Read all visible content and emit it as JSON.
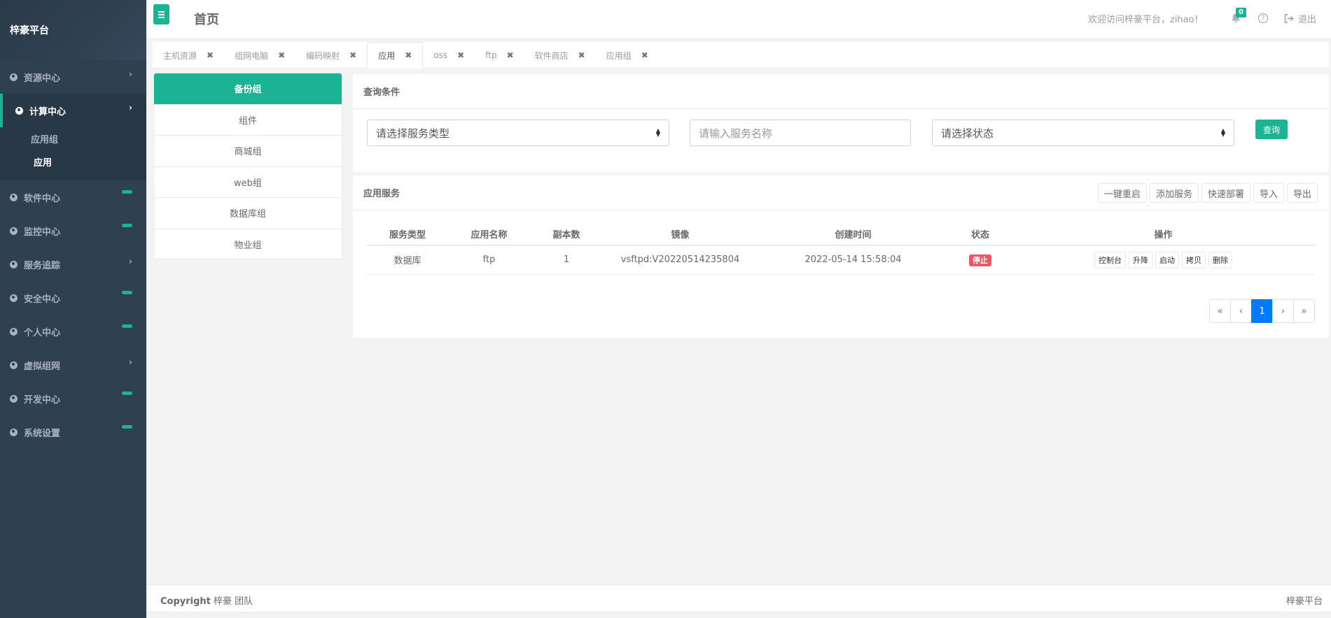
{
  "brand": "梓豪平台",
  "sidebar": {
    "items": [
      {
        "label": "资源中心",
        "marker": "chevron"
      },
      {
        "label": "计算中心",
        "marker": "chevron",
        "active": true
      },
      {
        "label": "软件中心",
        "marker": "pill"
      },
      {
        "label": "监控中心",
        "marker": "pill"
      },
      {
        "label": "服务追踪",
        "marker": "chevron"
      },
      {
        "label": "安全中心",
        "marker": "pill"
      },
      {
        "label": "个人中心",
        "marker": "pill"
      },
      {
        "label": "虚拟组网",
        "marker": "chevron"
      },
      {
        "label": "开发中心",
        "marker": "pill"
      },
      {
        "label": "系统设置",
        "marker": "pill"
      }
    ],
    "subitems": [
      {
        "label": "应用组"
      },
      {
        "label": "应用",
        "active": true
      }
    ],
    "chevron": "›"
  },
  "topbar": {
    "title": "首页",
    "welcome": "欢迎访问梓豪平台，zihao！",
    "notification_count": "0",
    "help": "?",
    "logout": "退出"
  },
  "tabs": [
    {
      "label": "主机资源"
    },
    {
      "label": "组网电脑"
    },
    {
      "label": "编码映射"
    },
    {
      "label": "应用",
      "active": true
    },
    {
      "label": "oss"
    },
    {
      "label": "ftp"
    },
    {
      "label": "软件商店"
    },
    {
      "label": "应用组"
    }
  ],
  "tab_close": "✖",
  "groups": [
    {
      "label": "备份组",
      "active": true
    },
    {
      "label": "组件"
    },
    {
      "label": "商城组"
    },
    {
      "label": "web组"
    },
    {
      "label": "数据库组"
    },
    {
      "label": "物业组"
    }
  ],
  "query": {
    "title": "查询条件",
    "service_type_placeholder": "请选择服务类型",
    "service_name_placeholder": "请输入服务名称",
    "status_placeholder": "请选择状态",
    "button": "查询"
  },
  "service": {
    "title": "应用服务",
    "actions": [
      "一键重启",
      "添加服务",
      "快速部署",
      "导入",
      "导出"
    ],
    "columns": [
      "服务类型",
      "应用名称",
      "副本数",
      "镜像",
      "创建时间",
      "状态",
      "操作"
    ],
    "rows": [
      {
        "type": "数据库",
        "name": "ftp",
        "replicas": "1",
        "image": "vsftpd:V20220514235804",
        "created": "2022-05-14 15:58:04",
        "status": "停止",
        "ops": [
          "控制台",
          "升降",
          "启动",
          "拷贝",
          "删除"
        ]
      }
    ],
    "pagination": {
      "first": "«",
      "prev": "‹",
      "current": "1",
      "next": "›",
      "last": "»"
    }
  },
  "footer": {
    "copyright_label": "Copyright",
    "copyright_text": " 梓豪 团队",
    "right": "梓豪平台"
  },
  "colors": {
    "accent": "#1ab394",
    "sidebar": "#2f4050",
    "danger": "#ed5565",
    "page_active": "#007bff"
  }
}
